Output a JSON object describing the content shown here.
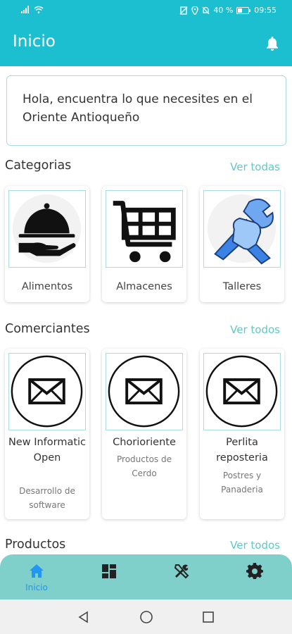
{
  "status": {
    "battery": "40 %",
    "time": "09:55"
  },
  "header": {
    "title": "Inicio"
  },
  "greeting": "Hola, encuentra lo que necesites en el Oriente Antioqueño",
  "categories": {
    "title": "Categorias",
    "see_all": "Ver todas",
    "items": [
      {
        "label": "Alimentos",
        "icon": "serving-cloche-icon"
      },
      {
        "label": "Almacenes",
        "icon": "shopping-cart-icon"
      },
      {
        "label": "Talleres",
        "icon": "wrench-hand-icon"
      }
    ]
  },
  "merchants": {
    "title": "Comerciantes",
    "see_all": "Ver todos",
    "items": [
      {
        "name": "New Informatic Open",
        "desc": "Desarrollo de software"
      },
      {
        "name": "Chorioriente",
        "desc": "Productos de Cerdo"
      },
      {
        "name": "Perlita reposteria",
        "desc": "Postres y Panaderia"
      }
    ]
  },
  "products": {
    "title": "Productos",
    "see_all": "Ver todos"
  },
  "bottom_nav": {
    "items": [
      {
        "label": "Inicio",
        "icon": "home-icon",
        "active": true
      },
      {
        "label": "",
        "icon": "dashboard-icon"
      },
      {
        "label": "",
        "icon": "tools-icon"
      },
      {
        "label": "",
        "icon": "settings-icon"
      }
    ]
  },
  "colors": {
    "primary": "#1cbfcf",
    "accent": "#5fc8c8",
    "nav_bg": "#7fcfcb",
    "active": "#2196f3"
  }
}
